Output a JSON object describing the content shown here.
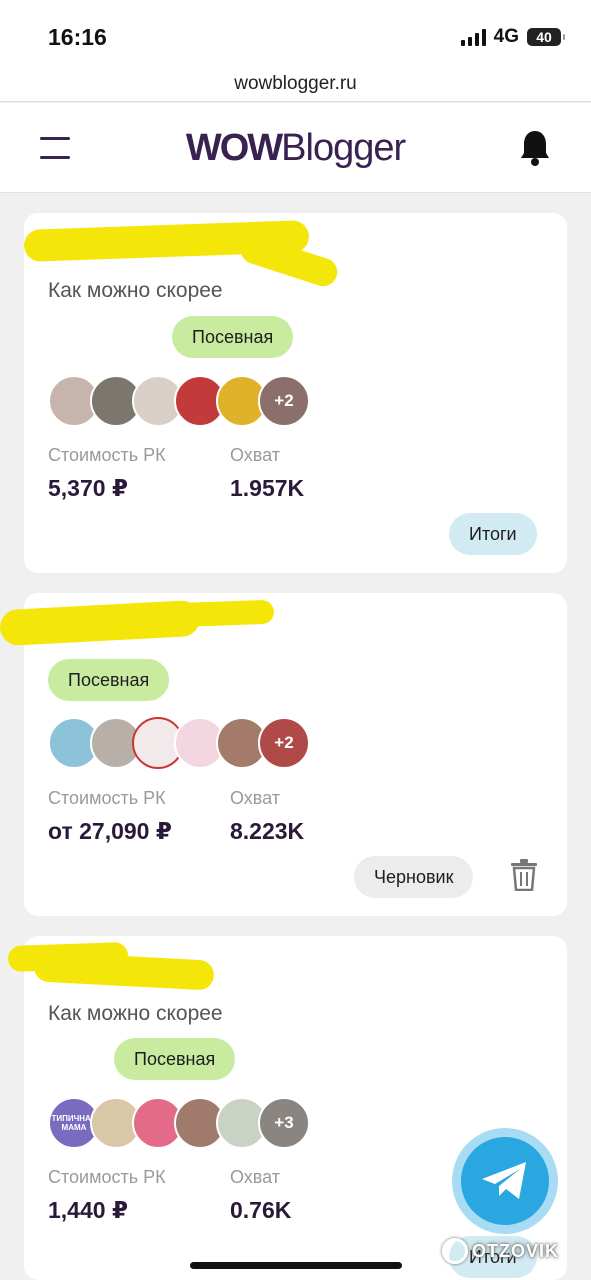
{
  "status_bar": {
    "time": "16:16",
    "network": "4G",
    "battery": "40"
  },
  "url_bar": {
    "url": "wowblogger.ru"
  },
  "header": {
    "logo_bold": "WOW",
    "logo_light": "Blogger"
  },
  "stats_labels": {
    "cost": "Стоимость РК",
    "reach": "Охват"
  },
  "cards": [
    {
      "title": "Как можно скорее",
      "tag": "Посевная",
      "avatars": [
        "#c7b5ad",
        "#7b766e",
        "#d9cfc6",
        "#c23a3a",
        "#e0b22a",
        "#8a6f6a"
      ],
      "more": "+2",
      "cost": "5,370 ₽",
      "reach": "1.957K",
      "action": "Итоги"
    },
    {
      "title": "",
      "tag": "Посевная",
      "avatars": [
        "#8dc3d9",
        "#b8b0a8",
        "#f2eaea",
        "#f3d6df",
        "#a47a6a",
        "#b04a48"
      ],
      "more": "+2",
      "cost": "от 27,090 ₽",
      "reach": "8.223K",
      "action": "Черновик"
    },
    {
      "title": "Как можно скорее",
      "tag": "Посевная",
      "avatars": [
        "#7a6bc0",
        "#d9c7a8",
        "#e46a8a",
        "#a07a6a",
        "#c9d2c4",
        "#8a8580"
      ],
      "avatar_text": [
        "ТИПИЧНАЯ МАМА"
      ],
      "more": "+3",
      "cost": "1,440 ₽",
      "reach": "0.76K",
      "action": "Итоги"
    }
  ],
  "watermark": "OTZOVIK",
  "colors": {
    "brand": "#3a2250",
    "tag_bg": "#c8eba0",
    "itogi_bg": "#d2eaf2",
    "telegram": "#2aa6e0"
  }
}
